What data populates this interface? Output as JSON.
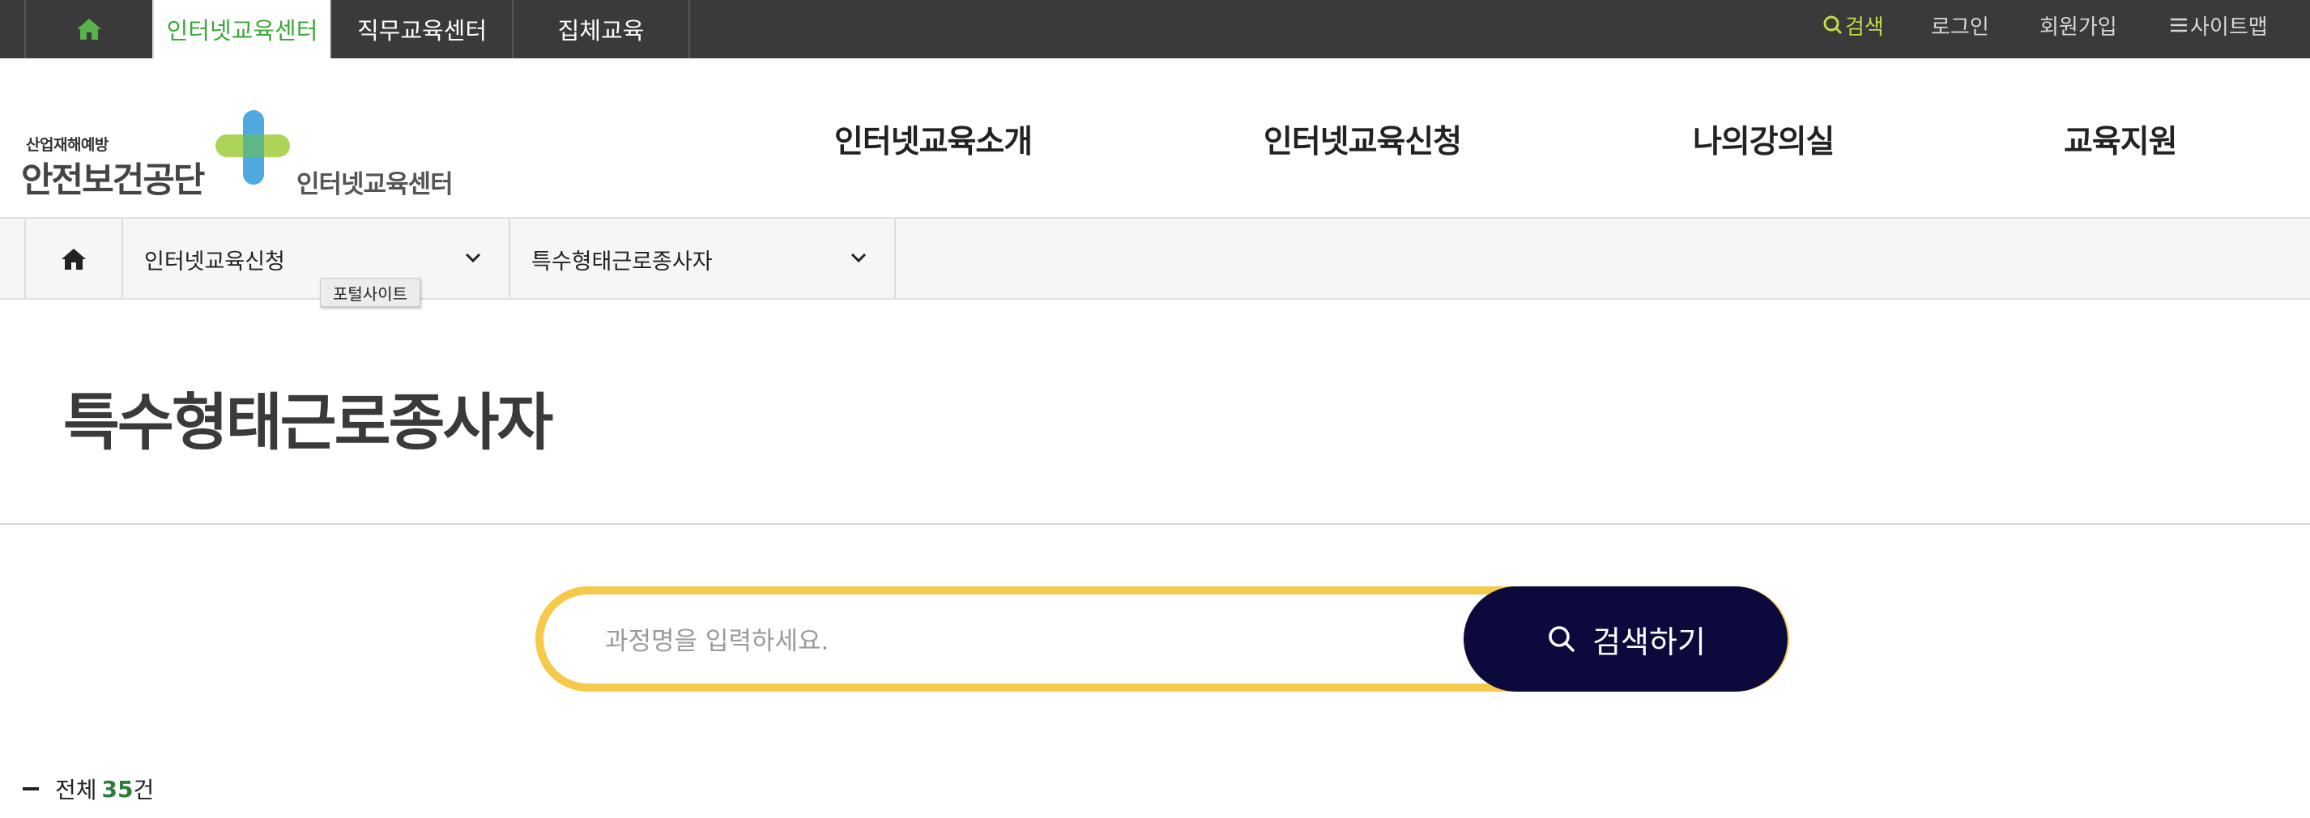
{
  "topbar": {
    "tabs": [
      {
        "label": ""
      },
      {
        "label": "인터넷교육센터"
      },
      {
        "label": "직무교육센터"
      },
      {
        "label": "집체교육"
      }
    ],
    "utils": {
      "search": "검색",
      "login": "로그인",
      "join": "회원가입",
      "sitemap": "사이트맵"
    }
  },
  "header": {
    "logo": {
      "sub": "산업재해예방",
      "main": "안전보건공단",
      "center": "인터넷교육센터"
    },
    "gnb": [
      "인터넷교육소개",
      "인터넷교육신청",
      "나의강의실",
      "교육지원"
    ]
  },
  "breadcrumb": {
    "level1": "인터넷교육신청",
    "level2": "특수형태근로종사자",
    "tooltip": "포털사이트"
  },
  "page": {
    "title": "특수형태근로종사자"
  },
  "search": {
    "placeholder": "과정명을 입력하세요.",
    "value": "",
    "button_label": "검색하기"
  },
  "total": {
    "prefix": "전체",
    "count": "35",
    "suffix": "건"
  },
  "colors": {
    "topbar_bg": "#3a3a3a",
    "active_tab_text": "#3aa73a",
    "search_util": "#c7d94a",
    "search_border": "#f5c94a",
    "search_button": "#0c0a3c",
    "count_color": "#2f7d3a"
  },
  "icons": {
    "home_top": "home-icon",
    "search_util": "search-icon",
    "sitemap": "menu-icon",
    "home_crumb": "home-icon",
    "chevron": "chevron-down-icon",
    "search_button": "search-icon"
  }
}
